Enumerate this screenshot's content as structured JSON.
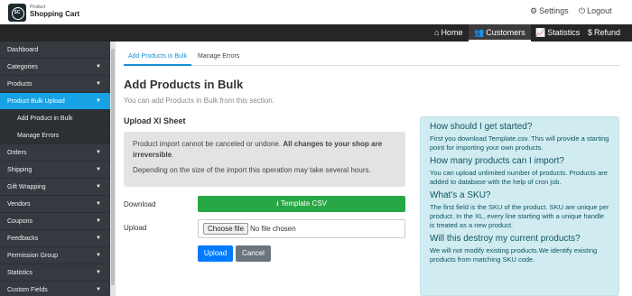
{
  "header": {
    "logo_mark": "SC",
    "logo_small": "Product",
    "logo_name": "Shopping Cart",
    "settings_label": "Settings",
    "logout_label": "Logout"
  },
  "nav": {
    "items": [
      {
        "label": "Home",
        "icon": "home-icon"
      },
      {
        "label": "Customers",
        "icon": "users-icon"
      },
      {
        "label": "Statistics",
        "icon": "chart-icon"
      },
      {
        "label": "Refund",
        "icon": "dollar-icon"
      }
    ],
    "active": "Customers"
  },
  "sidebar": {
    "items": [
      {
        "label": "Dashboard"
      },
      {
        "label": "Categories"
      },
      {
        "label": "Products"
      },
      {
        "label": "Product Bulk Upload"
      },
      {
        "label": "Add Product in Bulk"
      },
      {
        "label": "Manage Errors"
      },
      {
        "label": "Orders"
      },
      {
        "label": "Shipping"
      },
      {
        "label": "Gift Wrapping"
      },
      {
        "label": "Vendors"
      },
      {
        "label": "Coupons"
      },
      {
        "label": "Feedbacks"
      },
      {
        "label": "Permission Group"
      },
      {
        "label": "Statistics"
      },
      {
        "label": "Custom Fields"
      }
    ]
  },
  "tabs": [
    "Add Products in Bulk",
    "Manage Errors"
  ],
  "main": {
    "title": "Add Products in Bulk",
    "subtitle": "You can add Products in Bulk from this section.",
    "upload_title": "Upload Xl Sheet",
    "alert_text_1": "Product import cannot be canceled or undone.",
    "alert_text_bold": "All changes to your shop are irreversible",
    "alert_text_dot": ".",
    "alert_text_2": "Depending on the size of the import this operation may take several hours.",
    "download_label": "Download",
    "template_button": "Template CSV",
    "upload_label": "Upload",
    "choose_file": "Choose file",
    "no_file": "No file chosen",
    "upload_button": "Upload",
    "cancel_button": "Cancel"
  },
  "help": {
    "items": [
      {
        "q": "How should I get started?",
        "a": "First you download Template.csv. This will provide a starting point for importing your own products."
      },
      {
        "q": "How many products can I import?",
        "a": "You can upload unlimited number of products. Products are added to database with the help of cron job."
      },
      {
        "q": "What's a SKU?",
        "a": "The first field is the SKU of the product. SKU are unique per product. In the XL, every line starting with a unique handle is treated as a new product."
      },
      {
        "q": "Will this destroy my current products?",
        "a": "We will not modify existing products.We identify existing products from matching SKU code."
      }
    ]
  }
}
